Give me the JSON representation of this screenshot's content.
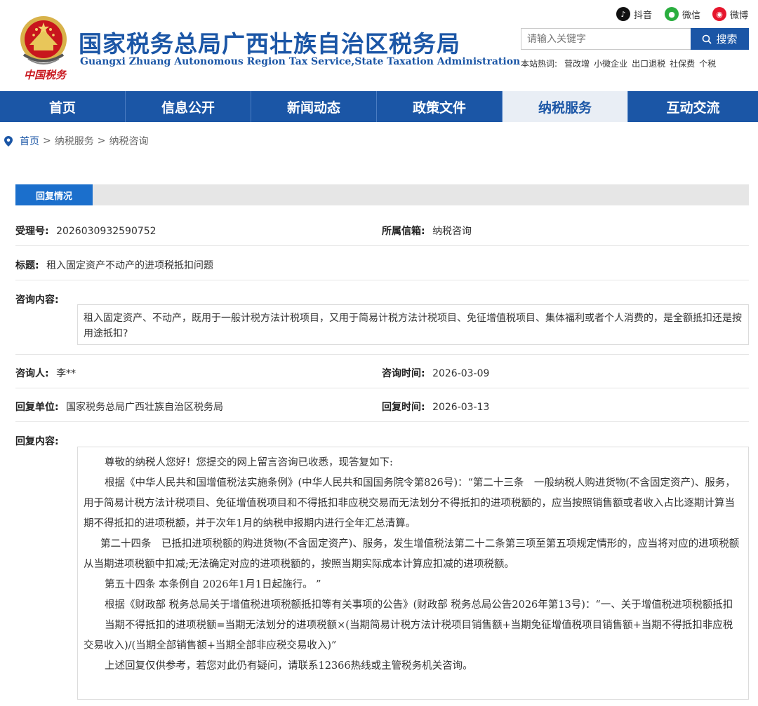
{
  "header": {
    "title_cn": "国家税务总局广西壮族自治区税务局",
    "title_en": "Guangxi Zhuang Autonomous Region Tax Service,State Taxation Administration",
    "emblem_text": "中国税务",
    "brand_color": "#1b56a6"
  },
  "social": {
    "douyin": "抖音",
    "wechat": "微信",
    "weibo": "微博"
  },
  "search": {
    "placeholder": "请输入关键字",
    "button_label": "搜索",
    "hot_label": "本站热词:",
    "hot_words": [
      "营改增",
      "小微企业",
      "出口退税",
      "社保费",
      "个税"
    ]
  },
  "nav": {
    "items": [
      "首页",
      "信息公开",
      "新闻动态",
      "政策文件",
      "纳税服务",
      "互动交流"
    ],
    "active": "纳税服务"
  },
  "breadcrumb": {
    "home": "首页",
    "sep": ">",
    "level1": "纳税服务",
    "level2": "纳税咨询"
  },
  "section": {
    "tab_label": "回复情况"
  },
  "record": {
    "accept_no_label": "受理号:",
    "accept_no": "2026030932590752",
    "mailbox_label": "所属信箱:",
    "mailbox": "纳税咨询",
    "title_label": "标题:",
    "title": "租入固定资产不动产的进项税抵扣问题",
    "consult_label": "咨询内容:",
    "consult_content": "租入固定资产、不动产，既用于一般计税方法计税项目，又用于简易计税方法计税项目、免征增值税项目、集体福利或者个人消费的，是全额抵扣还是按用途抵扣?",
    "consultant_label": "咨询人:",
    "consultant": "李**",
    "consult_time_label": "咨询时间:",
    "consult_time": "2026-03-09",
    "reply_unit_label": "回复单位:",
    "reply_unit": "国家税务总局广西壮族自治区税务局",
    "reply_time_label": "回复时间:",
    "reply_time": "2026-03-13",
    "reply_label": "回复内容:",
    "reply_paragraphs": [
      "尊敬的纳税人您好！您提交的网上留言咨询已收悉，现答复如下:",
      "根据《中华人民共和国增值税法实施条例》(中华人民共和国国务院令第826号)：“第二十三条　一般纳税人购进货物(不含固定资产)、服务，用于简易计税方法计税项目、免征增值税项目和不得抵扣非应税交易而无法划分不得抵扣的进项税额的，应当按照销售额或者收入占比逐期计算当期不得抵扣的进项税额，并于次年1月的纳税申报期内进行全年汇总清算。",
      "第二十四条　已抵扣进项税额的购进货物(不含固定资产)、服务，发生增值税法第二十二条第三项至第五项规定情形的，应当将对应的进项税额从当期进项税额中扣减;无法确定对应的进项税额的，按照当期实际成本计算应扣减的进项税额。",
      "第五十四条 本条例自 2026年1月1日起施行。 ”",
      "根据《财政部 税务总局关于增值税进项税额抵扣等有关事项的公告》(财政部 税务总局公告2026年第13号)：“一、关于增值税进项税额抵扣",
      "当期不得抵扣的进项税额=当期无法划分的进项税额×(当期简易计税方法计税项目销售额+当期免征增值税项目销售额+当期不得抵扣非应税交易收入)/(当期全部销售额+当期全部非应税交易收入)”",
      "上述回复仅供参考，若您对此仍有疑问，请联系12366热线或主管税务机关咨询。"
    ]
  }
}
